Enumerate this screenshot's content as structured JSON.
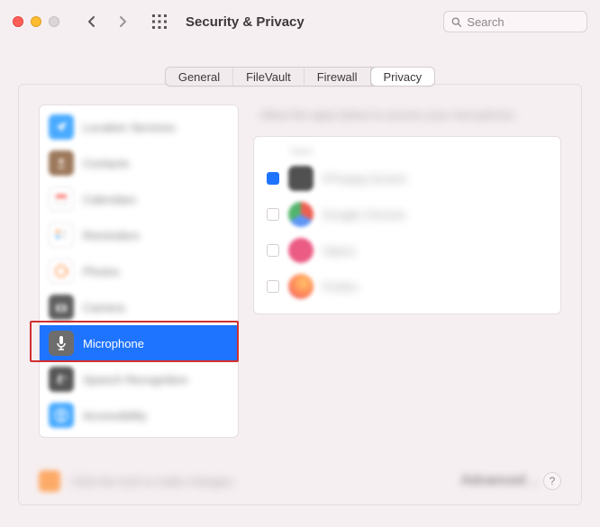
{
  "window": {
    "title": "Security & Privacy"
  },
  "search": {
    "placeholder": "Search",
    "value": ""
  },
  "tabs": [
    {
      "label": "General",
      "selected": false
    },
    {
      "label": "FileVault",
      "selected": false
    },
    {
      "label": "Firewall",
      "selected": false
    },
    {
      "label": "Privacy",
      "selected": true
    }
  ],
  "sidebar": {
    "items": [
      {
        "label": "Location Services",
        "icon": "location-icon",
        "selected": false
      },
      {
        "label": "Contacts",
        "icon": "contacts-icon",
        "selected": false
      },
      {
        "label": "Calendars",
        "icon": "calendars-icon",
        "selected": false
      },
      {
        "label": "Reminders",
        "icon": "reminders-icon",
        "selected": false
      },
      {
        "label": "Photos",
        "icon": "photos-icon",
        "selected": false
      },
      {
        "label": "Camera",
        "icon": "camera-icon",
        "selected": false
      },
      {
        "label": "Microphone",
        "icon": "microphone-icon",
        "selected": true
      },
      {
        "label": "Speech Recognition",
        "icon": "speech-icon",
        "selected": false
      },
      {
        "label": "Accessibility",
        "icon": "accessibility-icon",
        "selected": false
      }
    ]
  },
  "right_pane": {
    "heading": "Allow the apps below to access your microphone.",
    "subheading": "Apps",
    "apps": [
      {
        "name": "FFmpeg Screen",
        "checked": true,
        "color": "#333"
      },
      {
        "name": "Google Chrome",
        "checked": false,
        "color": "#fff"
      },
      {
        "name": "Opera",
        "checked": false,
        "color": "#e83f6f"
      },
      {
        "name": "Firefox",
        "checked": false,
        "color": "#ff8a3d"
      }
    ]
  },
  "footer": {
    "lock_text": "Click the lock to make changes.",
    "advanced_label": "Advanced…",
    "help_label": "?"
  },
  "colors": {
    "accent": "#1f74ff",
    "highlight": "#d22f2f"
  }
}
